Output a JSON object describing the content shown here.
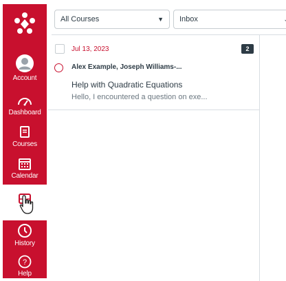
{
  "sidebar": {
    "items": [
      {
        "label": "Account",
        "icon": "account-icon"
      },
      {
        "label": "Dashboard",
        "icon": "dashboard-icon"
      },
      {
        "label": "Courses",
        "icon": "courses-icon"
      },
      {
        "label": "Calendar",
        "icon": "calendar-icon"
      },
      {
        "label": "History",
        "icon": "history-icon"
      },
      {
        "label": "Help",
        "icon": "help-icon"
      }
    ]
  },
  "filters": {
    "course": "All Courses",
    "mailbox": "Inbox"
  },
  "messages": [
    {
      "date": "Jul 13, 2023",
      "count": "2",
      "participants": "Alex Example, Joseph Williams-...",
      "subject": "Help with Quadratic Equations",
      "preview": "Hello, I encountered a question on exe..."
    }
  ],
  "colors": {
    "brand": "#c8102e",
    "badge": "#2d3b45"
  }
}
